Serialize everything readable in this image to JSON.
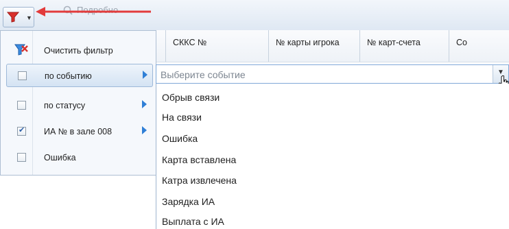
{
  "toolbar": {
    "filter_button_icon": "funnel-icon",
    "details_label": "Подробно"
  },
  "grid": {
    "columns": [
      "СККС №",
      "№ карты игрока",
      "№ карт-счета",
      "Со"
    ]
  },
  "filter_menu": {
    "clear_label": "Очистить фильтр",
    "items": [
      {
        "label": "по событию",
        "checked": false,
        "has_submenu": true,
        "active": true
      },
      {
        "label": "по статусу",
        "checked": false,
        "has_submenu": true,
        "active": false
      },
      {
        "label": "ИА № в зале 008",
        "checked": true,
        "has_submenu": true,
        "active": false
      },
      {
        "label": "Ошибка",
        "checked": false,
        "has_submenu": false,
        "active": false
      }
    ]
  },
  "event_combo": {
    "placeholder": "Выберите событие",
    "options": [
      "Обрыв связи",
      "На связи",
      "Ошибка",
      "Карта вставлена",
      "Катра извлечена",
      "Зарядка ИА",
      "Выплата с ИА"
    ]
  },
  "colors": {
    "accent": "#2f7fd6",
    "funnel": "#d9302c",
    "arrow": "#e23b3b"
  }
}
